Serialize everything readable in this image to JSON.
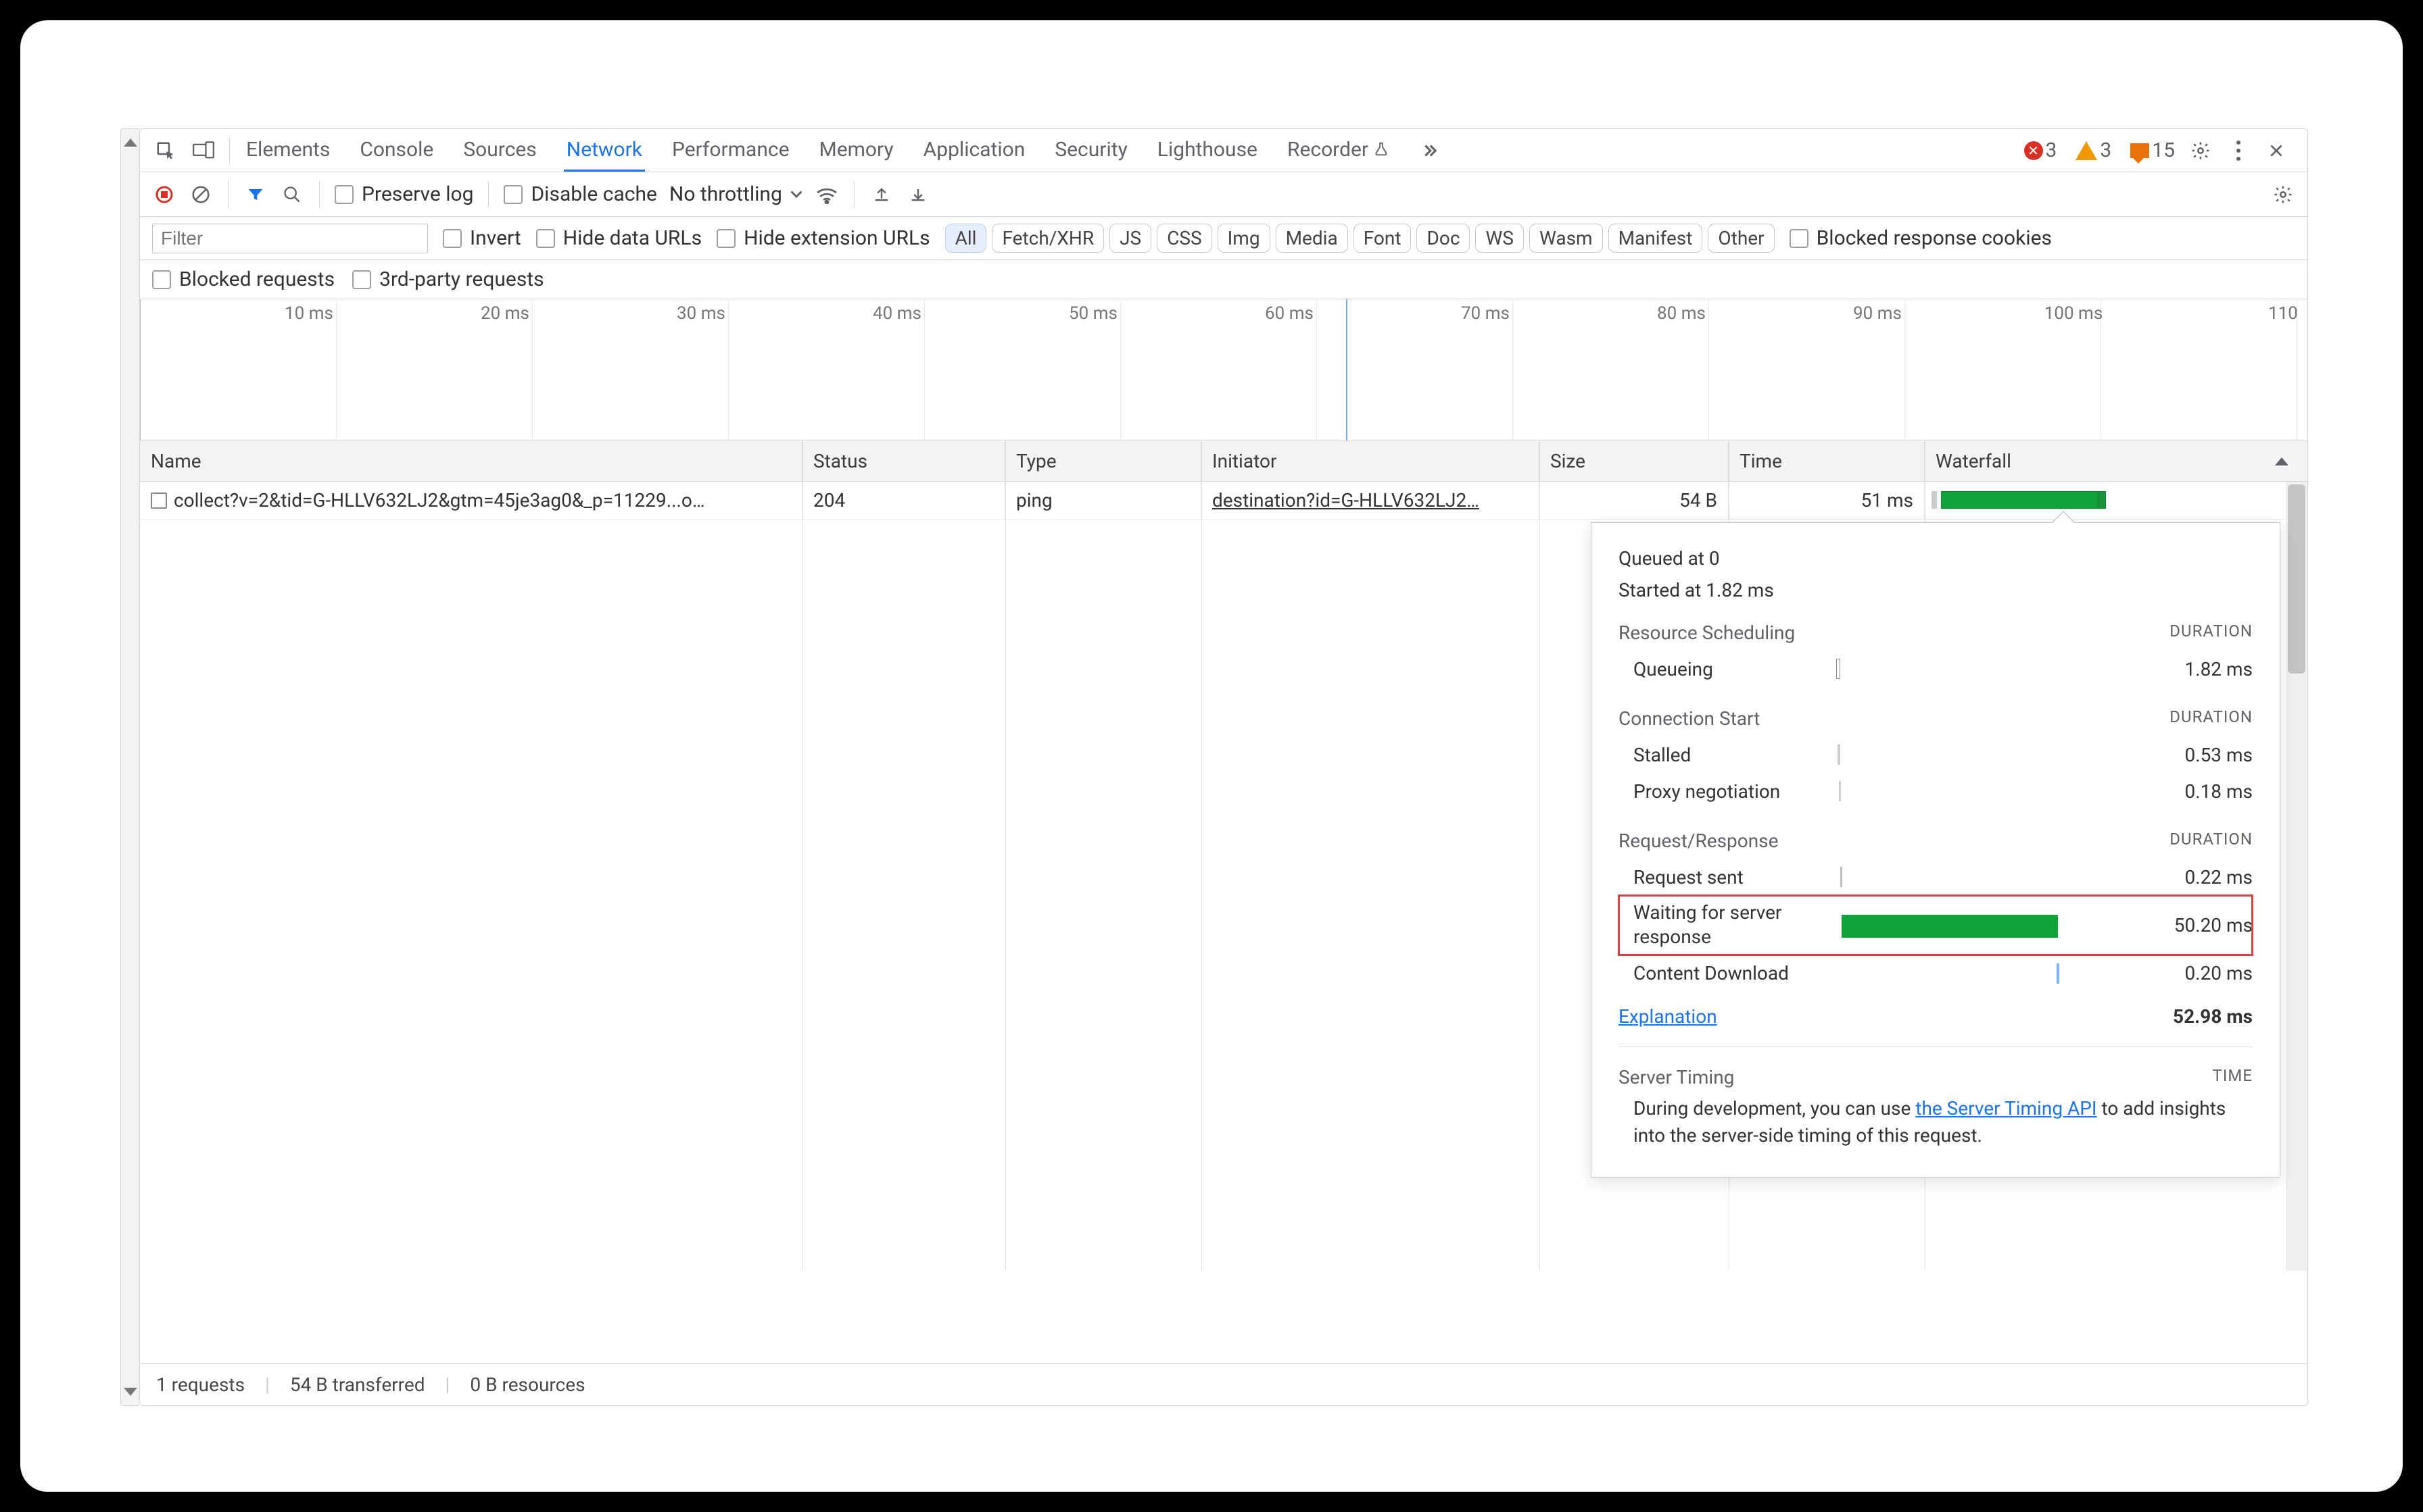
{
  "tabs": {
    "elements": "Elements",
    "console": "Console",
    "sources": "Sources",
    "network": "Network",
    "performance": "Performance",
    "memory": "Memory",
    "application": "Application",
    "security": "Security",
    "lighthouse": "Lighthouse",
    "recorder": "Recorder"
  },
  "corner": {
    "errors": "3",
    "warnings": "3",
    "issues": "15"
  },
  "toolbar": {
    "preserve": "Preserve log",
    "disable_cache": "Disable cache",
    "throttling": "No throttling"
  },
  "filter": {
    "placeholder": "Filter",
    "invert": "Invert",
    "hide_data": "Hide data URLs",
    "hide_ext": "Hide extension URLs",
    "blocked_cookies": "Blocked response cookies",
    "blocked_req": "Blocked requests",
    "third_party": "3rd-party requests",
    "chips": {
      "all": "All",
      "fetch": "Fetch/XHR",
      "js": "JS",
      "css": "CSS",
      "img": "Img",
      "media": "Media",
      "font": "Font",
      "doc": "Doc",
      "ws": "WS",
      "wasm": "Wasm",
      "manifest": "Manifest",
      "other": "Other"
    }
  },
  "timeline": {
    "ticks": [
      "10 ms",
      "20 ms",
      "30 ms",
      "40 ms",
      "50 ms",
      "60 ms",
      "70 ms",
      "80 ms",
      "90 ms",
      "100 ms",
      "110"
    ]
  },
  "columns": {
    "name": "Name",
    "status": "Status",
    "type": "Type",
    "initiator": "Initiator",
    "size": "Size",
    "time": "Time",
    "waterfall": "Waterfall"
  },
  "row": {
    "name": "collect?v=2&tid=G-HLLV632LJ2&gtm=45je3ag0&_p=11229...o…",
    "status": "204",
    "type": "ping",
    "initiator": "destination?id=G-HLLV632LJ2…",
    "size": "54 B",
    "time": "51 ms"
  },
  "popup": {
    "queued": "Queued at 0",
    "started": "Started at 1.82 ms",
    "section1": "Resource Scheduling",
    "section2": "Connection Start",
    "section3": "Request/Response",
    "dur_label": "DURATION",
    "queueing": "Queueing",
    "queueing_v": "1.82 ms",
    "stalled": "Stalled",
    "stalled_v": "0.53 ms",
    "proxy": "Proxy negotiation",
    "proxy_v": "0.18 ms",
    "sent": "Request sent",
    "sent_v": "0.22 ms",
    "waiting": "Waiting for server response",
    "waiting_v": "50.20 ms",
    "download": "Content Download",
    "download_v": "0.20 ms",
    "explain": "Explanation",
    "total": "52.98 ms",
    "server_h": "Server Timing",
    "time_label": "TIME",
    "server_text1": "During development, you can use ",
    "server_link": "the Server Timing API",
    "server_text2": " to add insights into the server-side timing of this request."
  },
  "footer": {
    "req": "1 requests",
    "trans": "54 B transferred",
    "res": "0 B resources"
  }
}
